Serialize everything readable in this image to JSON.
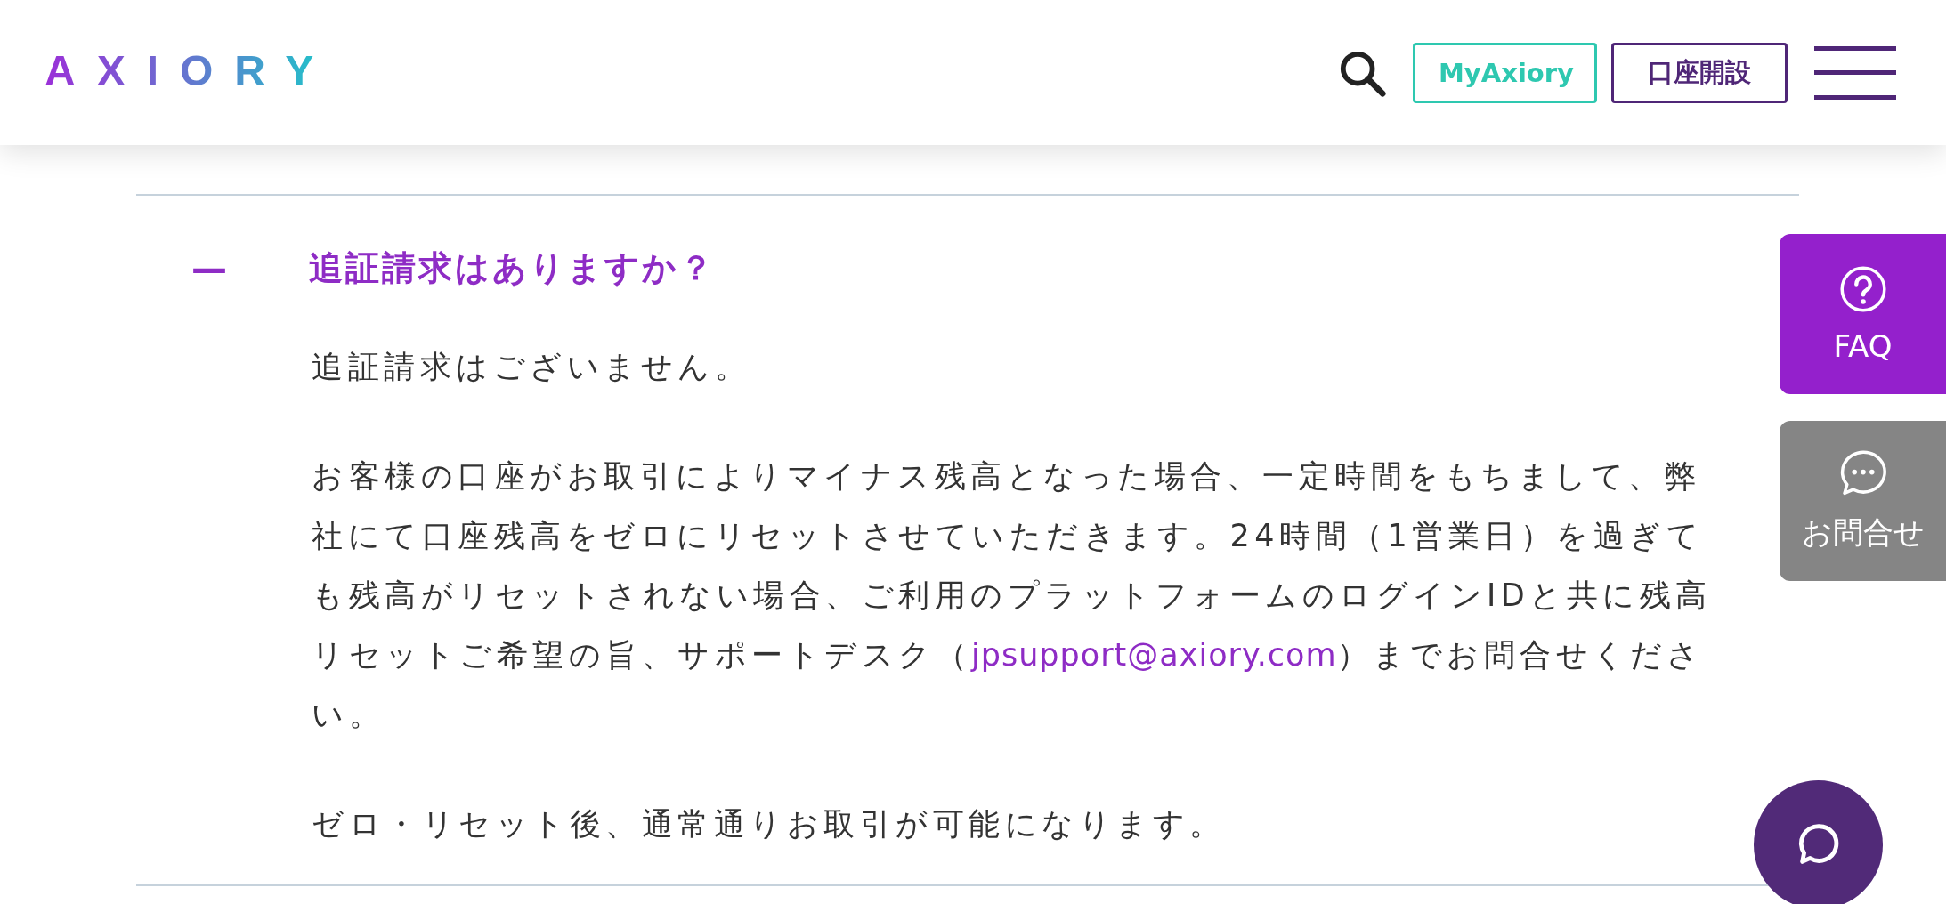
{
  "header": {
    "logo": "AXIORY",
    "buttons": [
      {
        "label": "MyAxiory",
        "kind": "outline-teal"
      },
      {
        "label": "口座開設",
        "kind": "outline-purple"
      }
    ]
  },
  "faq_item": {
    "expanded": true,
    "toggle": "—",
    "question": "追証請求はありますか？",
    "answer": [
      {
        "text": "追証請求はございません。"
      },
      {
        "text": "お客様の口座がお取引によりマイナス残高となった場合、一定時間をもちまして、弊社にて口座残高をゼロにリセットさせていただきます。24時間（1営業日）を過ぎても残高がリセットされない場合、ご利用のプラットフォームのログインIDと共に残高リセットご希望の旨、サポートデスク（",
        "link": "jpsupport@axiory.com",
        "after": "）までお問合せください。"
      },
      {
        "text": "ゼロ・リセット後、通常通りお取引が可能になります。"
      }
    ]
  },
  "side_buttons": [
    {
      "label": "FAQ",
      "kind": "faq"
    },
    {
      "label": "お問合せ",
      "kind": "contact"
    }
  ]
}
